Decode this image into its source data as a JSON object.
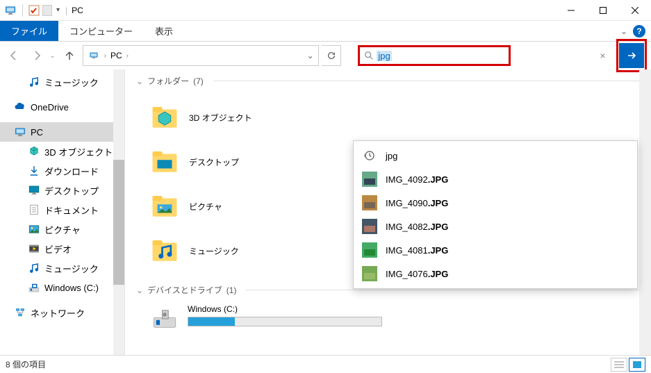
{
  "title": "PC",
  "ribbon": {
    "file": "ファイル",
    "computer": "コンピューター",
    "view": "表示",
    "help": "?"
  },
  "breadcrumb": {
    "location": "PC"
  },
  "search": {
    "value": "jpg",
    "clear": "×"
  },
  "tree": [
    {
      "icon": "music",
      "label": "ミュージック",
      "indent": true
    },
    {
      "gap": true
    },
    {
      "icon": "onedrive",
      "label": "OneDrive",
      "indent": false
    },
    {
      "gap": true
    },
    {
      "icon": "pc",
      "label": "PC",
      "indent": false,
      "selected": true
    },
    {
      "icon": "3d",
      "label": "3D オブジェクト",
      "indent": true
    },
    {
      "icon": "download",
      "label": "ダウンロード",
      "indent": true
    },
    {
      "icon": "desktop",
      "label": "デスクトップ",
      "indent": true
    },
    {
      "icon": "document",
      "label": "ドキュメント",
      "indent": true
    },
    {
      "icon": "picture",
      "label": "ピクチャ",
      "indent": true
    },
    {
      "icon": "video",
      "label": "ビデオ",
      "indent": true
    },
    {
      "icon": "music",
      "label": "ミュージック",
      "indent": true
    },
    {
      "icon": "drive",
      "label": "Windows (C:)",
      "indent": true
    },
    {
      "gap": true
    },
    {
      "icon": "network",
      "label": "ネットワーク",
      "indent": false
    }
  ],
  "groups": {
    "folders": {
      "label": "フォルダー",
      "count": "(7)",
      "items": [
        {
          "icon": "3d",
          "label": "3D オブジェクト"
        },
        {
          "icon": "desktop",
          "label": "デスクトップ"
        },
        {
          "icon": "picture",
          "label": "ピクチャ"
        },
        {
          "icon": "music",
          "label": "ミュージック"
        }
      ]
    },
    "devices": {
      "label": "デバイスとドライブ",
      "count": "(1)",
      "items": [
        {
          "icon": "drive",
          "label": "Windows (C:)"
        }
      ]
    }
  },
  "suggestions": [
    {
      "type": "history",
      "text": "jpg"
    },
    {
      "type": "img",
      "prefix": "IMG_4092",
      "suffix": ".JPG"
    },
    {
      "type": "img",
      "prefix": "IMG_4090",
      "suffix": ".JPG"
    },
    {
      "type": "img",
      "prefix": "IMG_4082",
      "suffix": ".JPG"
    },
    {
      "type": "img",
      "prefix": "IMG_4081",
      "suffix": ".JPG"
    },
    {
      "type": "img",
      "prefix": "IMG_4076",
      "suffix": ".JPG"
    }
  ],
  "extra_icons": {
    "video_tile": true
  },
  "status": {
    "text": "8 個の項目"
  }
}
